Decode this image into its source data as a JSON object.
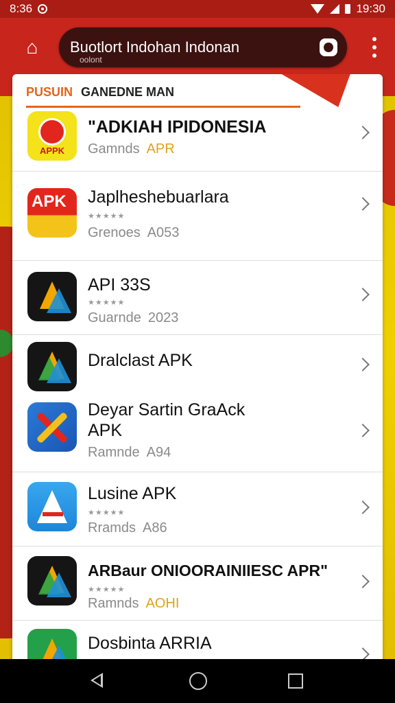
{
  "status_bar": {
    "time_left": "8:36",
    "time_right": "19:30"
  },
  "browser": {
    "url_text": "Buotlort Indohan Indonan",
    "url_sub": "oolont"
  },
  "card": {
    "header_orange": "PUSUIN",
    "header_dark": "GANEDNE MAN"
  },
  "apps": [
    {
      "name": "\"ADKIAH IPIDONESIA",
      "stars": "",
      "category": "Gamnds",
      "version": "APR",
      "icon": "apk-red-circle-icon",
      "version_color": "orange"
    },
    {
      "name": "Japlheshebuarlara",
      "stars": "★★★★★",
      "category": "Grenoes",
      "version": "A053",
      "icon": "apk-red-yellow-icon",
      "version_color": "gray"
    },
    {
      "name": "API 33S",
      "stars": "★★★★★",
      "category": "Guarnde",
      "version": "2023",
      "icon": "triangle-apk-icon",
      "version_color": "gray"
    },
    {
      "name": "Dralclast APK",
      "stars": "",
      "category": "",
      "version": "",
      "icon": "triangle-green-icon",
      "version_color": "gray"
    },
    {
      "name": "Deyar Sartin GraAck\nAPK",
      "stars": "",
      "category": "Ramnde",
      "version": "A94",
      "icon": "cross-blue-icon",
      "version_color": "gray"
    },
    {
      "name": "Lusine APK",
      "stars": "★★★★★",
      "category": "Rramds",
      "version": "A86",
      "icon": "blue-a-icon",
      "version_color": "gray"
    },
    {
      "name": "ARBaur ONIOORAINIIESC APR\"",
      "stars": "★★★★★",
      "category": "Ramnds",
      "version": "AOHI",
      "icon": "dark-triangle-icon",
      "version_color": "orange"
    },
    {
      "name": "Dosbinta ARRIA",
      "stars": "",
      "category": "",
      "version": "",
      "icon": "green-triangle-icon",
      "version_color": "gray"
    }
  ]
}
